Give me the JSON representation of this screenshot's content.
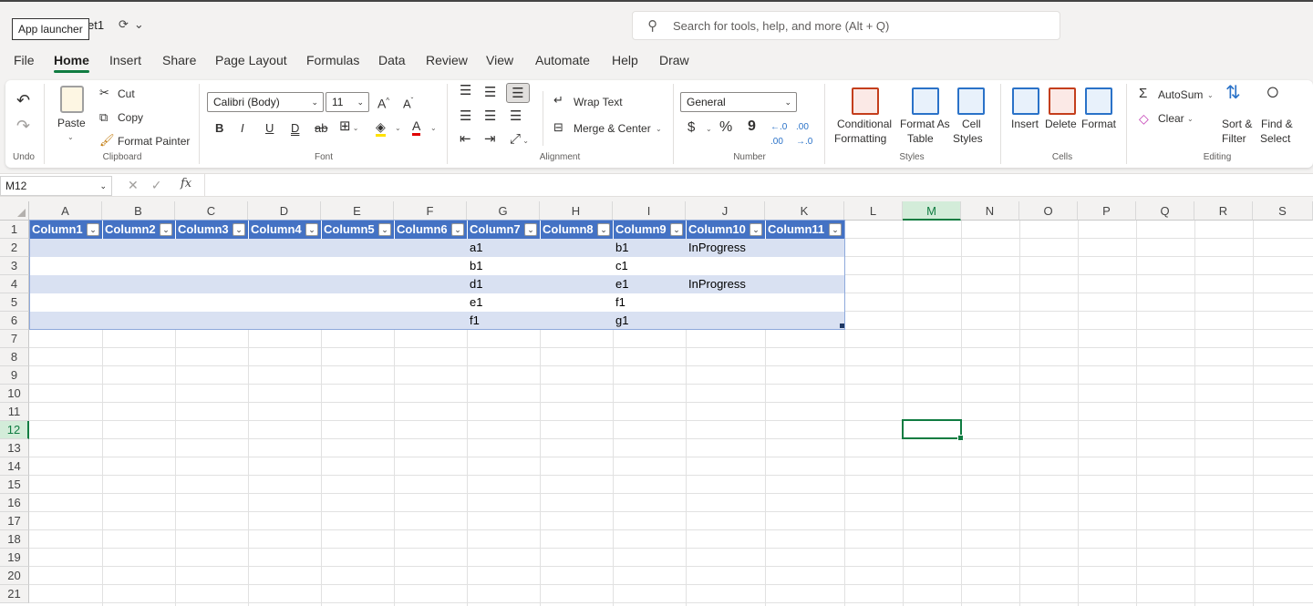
{
  "titlebar": {
    "tooltip": "App launcher",
    "doc_title_fragment": "et1",
    "search_placeholder": "Search for tools, help, and more (Alt + Q)"
  },
  "tabs": [
    "File",
    "Home",
    "Insert",
    "Share",
    "Page Layout",
    "Formulas",
    "Data",
    "Review",
    "View",
    "Automate",
    "Help",
    "Draw"
  ],
  "ribbon": {
    "groups": {
      "undo": "Undo",
      "clipboard": "Clipboard",
      "font": "Font",
      "alignment": "Alignment",
      "number": "Number",
      "styles": "Styles",
      "cells": "Cells",
      "editing": "Editing"
    },
    "clipboard": {
      "paste": "Paste",
      "cut": "Cut",
      "copy": "Copy",
      "format_painter": "Format Painter"
    },
    "font": {
      "name": "Calibri (Body)",
      "size": "11",
      "bold": "B",
      "italic": "I",
      "underline": "U",
      "double_underline": "D",
      "strike": "ab",
      "font_color": "A"
    },
    "alignment": {
      "wrap_text": "Wrap Text",
      "merge_center": "Merge & Center"
    },
    "number": {
      "format": "General",
      "currency": "$",
      "percent": "%",
      "comma": "9"
    },
    "styles": {
      "conditional_1": "Conditional",
      "conditional_2": "Formatting",
      "format_as_1": "Format As",
      "format_as_2": "Table",
      "cell_1": "Cell",
      "cell_2": "Styles"
    },
    "cells": {
      "insert": "Insert",
      "delete": "Delete",
      "format": "Format"
    },
    "editing": {
      "autosum": "AutoSum",
      "clear": "Clear",
      "sort_1": "Sort &",
      "sort_2": "Filter",
      "find_1": "Find &",
      "find_2": "Select"
    }
  },
  "formula_bar": {
    "name_box": "M12",
    "fx": "fx",
    "value": ""
  },
  "sheet": {
    "columns": [
      "A",
      "B",
      "C",
      "D",
      "E",
      "F",
      "G",
      "H",
      "I",
      "J",
      "K",
      "L",
      "M",
      "N",
      "O",
      "P",
      "Q",
      "R",
      "S"
    ],
    "rows": [
      "1",
      "2",
      "3",
      "4",
      "5",
      "6",
      "7",
      "8",
      "9",
      "10",
      "11",
      "12",
      "13",
      "14",
      "15",
      "16",
      "17",
      "18",
      "19",
      "20",
      "21"
    ],
    "selected_column": "M",
    "selected_row": "12",
    "table": {
      "headers": [
        "Column1",
        "Column2",
        "Column3",
        "Column4",
        "Column5",
        "Column6",
        "Column7",
        "Column8",
        "Column9",
        "Column10",
        "Column11"
      ],
      "rows": [
        [
          "",
          "",
          "",
          "",
          "",
          "",
          "a1",
          "",
          "b1",
          "InProgress",
          ""
        ],
        [
          "",
          "",
          "",
          "",
          "",
          "",
          "b1",
          "",
          "c1",
          "",
          ""
        ],
        [
          "",
          "",
          "",
          "",
          "",
          "",
          "d1",
          "",
          "e1",
          "InProgress",
          ""
        ],
        [
          "",
          "",
          "",
          "",
          "",
          "",
          "e1",
          "",
          "f1",
          "",
          ""
        ],
        [
          "",
          "",
          "",
          "",
          "",
          "",
          "f1",
          "",
          "g1",
          "",
          ""
        ]
      ]
    }
  },
  "colors": {
    "accent": "#107c41",
    "table_header": "#4472c4",
    "table_band": "#d9e1f2"
  }
}
